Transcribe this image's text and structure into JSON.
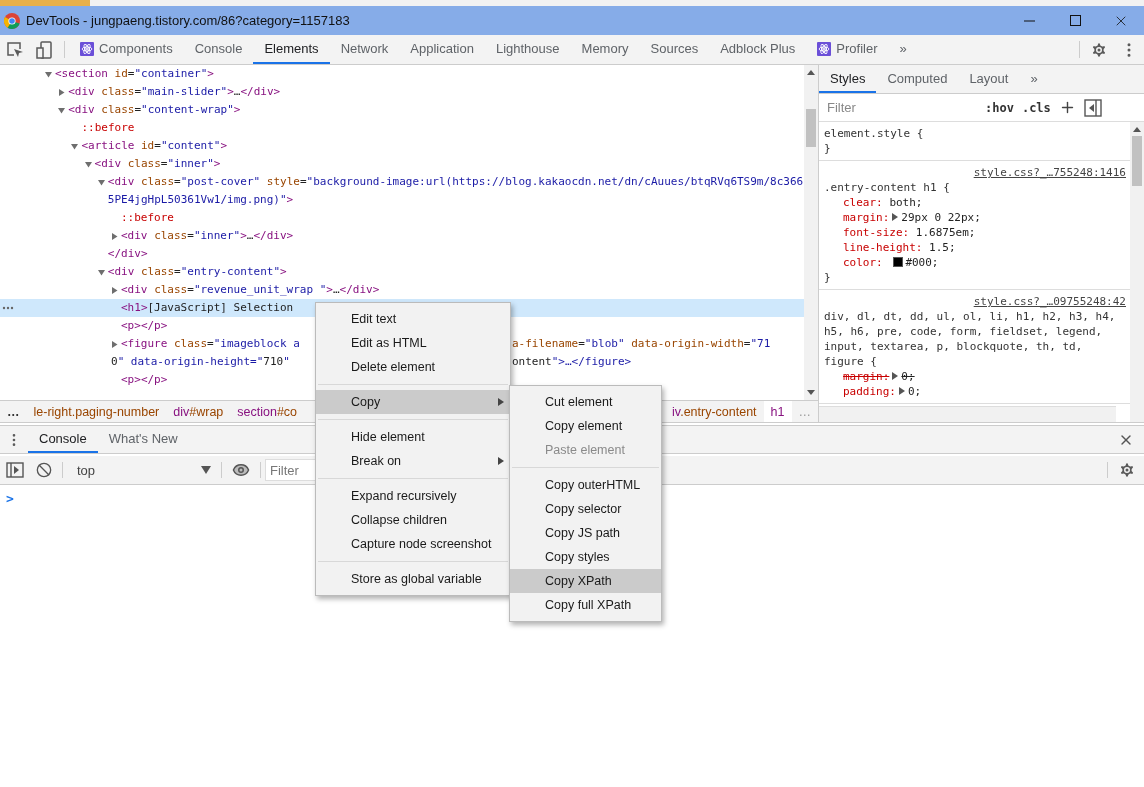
{
  "window": {
    "title": "DevTools - jungpaeng.tistory.com/86?category=1157183"
  },
  "toolbar": {
    "tabs": [
      {
        "label": "Components",
        "kind": "plugin",
        "selected": false
      },
      {
        "label": "Console",
        "kind": "builtin",
        "selected": false
      },
      {
        "label": "Elements",
        "kind": "builtin",
        "selected": true
      },
      {
        "label": "Network",
        "kind": "builtin",
        "selected": false
      },
      {
        "label": "Application",
        "kind": "builtin",
        "selected": false
      },
      {
        "label": "Lighthouse",
        "kind": "builtin",
        "selected": false
      },
      {
        "label": "Memory",
        "kind": "builtin",
        "selected": false
      },
      {
        "label": "Sources",
        "kind": "builtin",
        "selected": false
      },
      {
        "label": "Adblock Plus",
        "kind": "builtin",
        "selected": false
      },
      {
        "label": "Profiler",
        "kind": "plugin",
        "selected": false
      }
    ],
    "more": "»"
  },
  "elements": {
    "tree": [
      {
        "text": "<section id=\"container\">",
        "expanded": true,
        "selected": false,
        "children": [
          {
            "text": "<div class=\"main-slider\">…</div>",
            "expanded": false,
            "selected": false
          },
          {
            "text": "<div class=\"content-wrap\">",
            "expanded": true,
            "selected": false,
            "children": [
              {
                "text": "::before",
                "selected": false
              },
              {
                "text": "<article id=\"content\">",
                "expanded": true,
                "selected": false,
                "children": [
                  {
                    "text": "<div class=\"inner\">",
                    "expanded": true,
                    "selected": false,
                    "children": [
                      {
                        "text": "<div class=\"post-cover\" style=\"background-image:url(https://blog.kakaocdn.net/dn/cAuues/btqRVq6TS9m/8c3665PE4jgHpL50361Vw1/img.png)\">",
                        "expanded": true,
                        "selected": false,
                        "children": [
                          {
                            "text": "::before",
                            "selected": false
                          },
                          {
                            "text": "<div class=\"inner\">…</div>",
                            "expanded": false,
                            "selected": false
                          }
                        ]
                      },
                      {
                        "text": "</div>",
                        "selected": false
                      },
                      {
                        "text": "<div class=\"entry-content\">",
                        "expanded": true,
                        "selected": false,
                        "children": [
                          {
                            "text": "<div class=\"revenue_unit_wrap \">…</div>",
                            "expanded": false,
                            "selected": false
                          },
                          {
                            "text": "<h1>[JavaScript] Selection",
                            "selected": true
                          },
                          {
                            "text": "<p></p>",
                            "selected": false
                          },
                          {
                            "rows": [
                              [
                                "<figure class=\"imageblock a",
                                "a-filename=\"blob\" data-origin-width=\"71"
                              ],
                              [
                                "0\" data-origin-height=\"710\" ",
                                "ontent\">…</figure>"
                              ]
                            ],
                            "expanded": false,
                            "selected": false
                          },
                          {
                            "text": "<p></p>",
                            "selected": false
                          }
                        ]
                      }
                    ]
                  }
                ]
              }
            ]
          }
        ]
      }
    ]
  },
  "breadcrumbs": {
    "more": "…",
    "left": [
      {
        "rest": "le-right.paging-number",
        "selected": false
      },
      {
        "tag": "div",
        "rest": "#wrap",
        "selected": false
      },
      {
        "tag": "section",
        "rest": "#co",
        "selected": false
      }
    ],
    "right": [
      {
        "tag": "iv",
        "rest": ".entry-content",
        "selected": false
      },
      {
        "tag": "h1",
        "selected": true
      }
    ],
    "trailing": "…"
  },
  "styles": {
    "tabs": [
      {
        "label": "Styles",
        "selected": true
      },
      {
        "label": "Computed",
        "selected": false
      },
      {
        "label": "Layout",
        "selected": false
      }
    ],
    "more": "»",
    "filter": {
      "placeholder": "Filter"
    },
    "hov": ":hov",
    "cls": ".cls",
    "rules": [
      {
        "selector": "element.style {",
        "close": "}"
      },
      {
        "selector": ".entry-content h1 {",
        "source": "style.css?_…755248:1416",
        "close": "}",
        "properties": [
          {
            "name": "clear:",
            "value": "both;",
            "expandable": false,
            "overridden": false
          },
          {
            "name": "margin:",
            "value": "29px 0 22px;",
            "expandable": true,
            "overridden": false
          },
          {
            "name": "font-size:",
            "value": "1.6875em;",
            "expandable": false,
            "overridden": false
          },
          {
            "name": "line-height:",
            "value": "1.5;",
            "expandable": false,
            "overridden": false
          },
          {
            "name": "color:",
            "value": "#000;",
            "expandable": false,
            "overridden": false,
            "color": "#000000"
          }
        ]
      },
      {
        "selector": "div, dl, dt, dd, ul, ol, li, h1, h2, h3, h4, h5, h6, pre, code, form, fieldset, legend, input, textarea, p, blockquote, th, td, figure {",
        "source": "style.css?_…09755248:42",
        "properties": [
          {
            "name": "margin:",
            "value": "0;",
            "expandable": true,
            "overridden": true
          },
          {
            "name": "padding:",
            "value": "0;",
            "expandable": true,
            "overridden": false
          }
        ]
      }
    ]
  },
  "drawer": {
    "tabs": [
      {
        "label": "Console",
        "selected": true
      },
      {
        "label": "What's New",
        "selected": false
      }
    ],
    "context": "top",
    "filter": {
      "placeholder": "Filter"
    },
    "prompt": ">"
  },
  "context_menu": {
    "groups": [
      [
        {
          "label": "Edit text",
          "has_submenu": false,
          "selected": false
        },
        {
          "label": "Edit as HTML",
          "has_submenu": false,
          "selected": false
        },
        {
          "label": "Delete element",
          "has_submenu": false,
          "selected": false
        }
      ],
      [
        {
          "label": "Copy",
          "has_submenu": true,
          "selected": true
        }
      ],
      [
        {
          "label": "Hide element",
          "has_submenu": false,
          "selected": false
        },
        {
          "label": "Break on",
          "has_submenu": true,
          "selected": false
        }
      ],
      [
        {
          "label": "Expand recursively",
          "has_submenu": false,
          "selected": false
        },
        {
          "label": "Collapse children",
          "has_submenu": false,
          "selected": false
        },
        {
          "label": "Capture node screenshot",
          "has_submenu": false,
          "selected": false
        }
      ],
      [
        {
          "label": "Store as global variable",
          "has_submenu": false,
          "selected": false
        }
      ]
    ]
  },
  "submenu": {
    "groups": [
      [
        {
          "label": "Cut element",
          "disabled": false,
          "selected": false
        },
        {
          "label": "Copy element",
          "disabled": false,
          "selected": false
        },
        {
          "label": "Paste element",
          "disabled": true,
          "selected": false
        }
      ],
      [
        {
          "label": "Copy outerHTML",
          "disabled": false,
          "selected": false
        },
        {
          "label": "Copy selector",
          "disabled": false,
          "selected": false
        },
        {
          "label": "Copy JS path",
          "disabled": false,
          "selected": false
        },
        {
          "label": "Copy styles",
          "disabled": false,
          "selected": false
        },
        {
          "label": "Copy XPath",
          "disabled": false,
          "selected": true
        },
        {
          "label": "Copy full XPath",
          "disabled": false,
          "selected": false
        }
      ]
    ]
  }
}
